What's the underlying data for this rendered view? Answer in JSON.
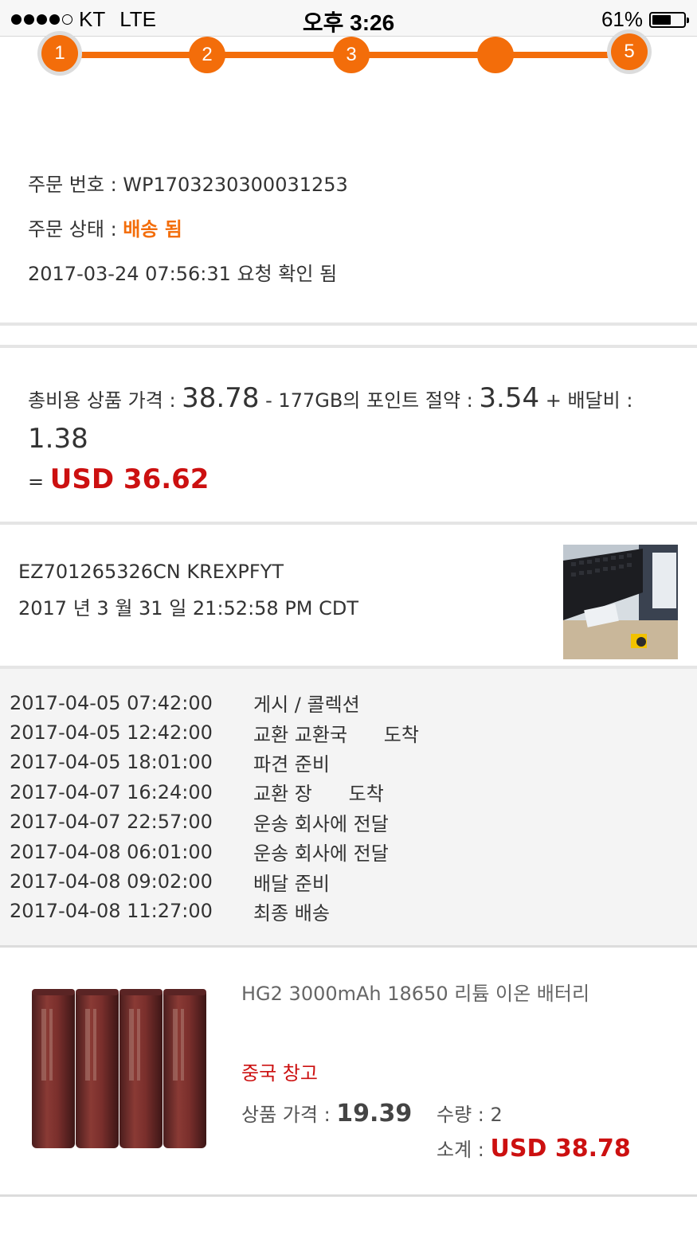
{
  "status_bar": {
    "carrier": "KT",
    "network": "LTE",
    "time": "오후 3:26",
    "battery_percent": "61%",
    "battery_level": 0.61
  },
  "progress": {
    "steps": [
      "1",
      "2",
      "3",
      "",
      "5"
    ],
    "accent_color": "#f36d0a"
  },
  "order": {
    "number_label": "주문 번호 : ",
    "number": "WP1703230300031253",
    "status_label": "주문 상태 : ",
    "status": "배송 됨",
    "confirmed": "2017-03-24 07:56:31 요청 확인 됨"
  },
  "totals": {
    "prefix": "총비용 상품 가격 : ",
    "goods_price": "38.78",
    "points_label": " - 177GB의  포인트 절약 : ",
    "points_saved": "3.54",
    "shipping_label": " + 배달비 : ",
    "shipping": "1.38",
    "equals": "= ",
    "total": "USD 36.62"
  },
  "tracking": {
    "number": "EZ701265326CN KREXPFYT",
    "datetime": "2017 년 3 월 31 일 21:52:58 PM CDT",
    "history": [
      {
        "time": "2017-04-05 07:42:00",
        "event": "게시 / 콜렉션"
      },
      {
        "time": "2017-04-05 12:42:00",
        "event": "교환 교환국      도착"
      },
      {
        "time": "2017-04-05 18:01:00",
        "event": "파견 준비"
      },
      {
        "time": "2017-04-07 16:24:00",
        "event": "교환 장      도착"
      },
      {
        "time": "2017-04-07 22:57:00",
        "event": "운송 회사에 전달"
      },
      {
        "time": "2017-04-08 06:01:00",
        "event": "운송 회사에 전달"
      },
      {
        "time": "2017-04-08 09:02:00",
        "event": "배달 준비"
      },
      {
        "time": "2017-04-08 11:27:00",
        "event": "최종 배송"
      }
    ]
  },
  "product": {
    "name": "HG2 3000mAh 18650 리튬 이온 배터리",
    "warehouse": "중국 창고",
    "price_label": "상품 가격 : ",
    "price": "19.39",
    "qty_label": "수량 : ",
    "qty": "2",
    "subtotal_label": "소계 : ",
    "subtotal": "USD 38.78",
    "price_color": "#cc1010"
  }
}
